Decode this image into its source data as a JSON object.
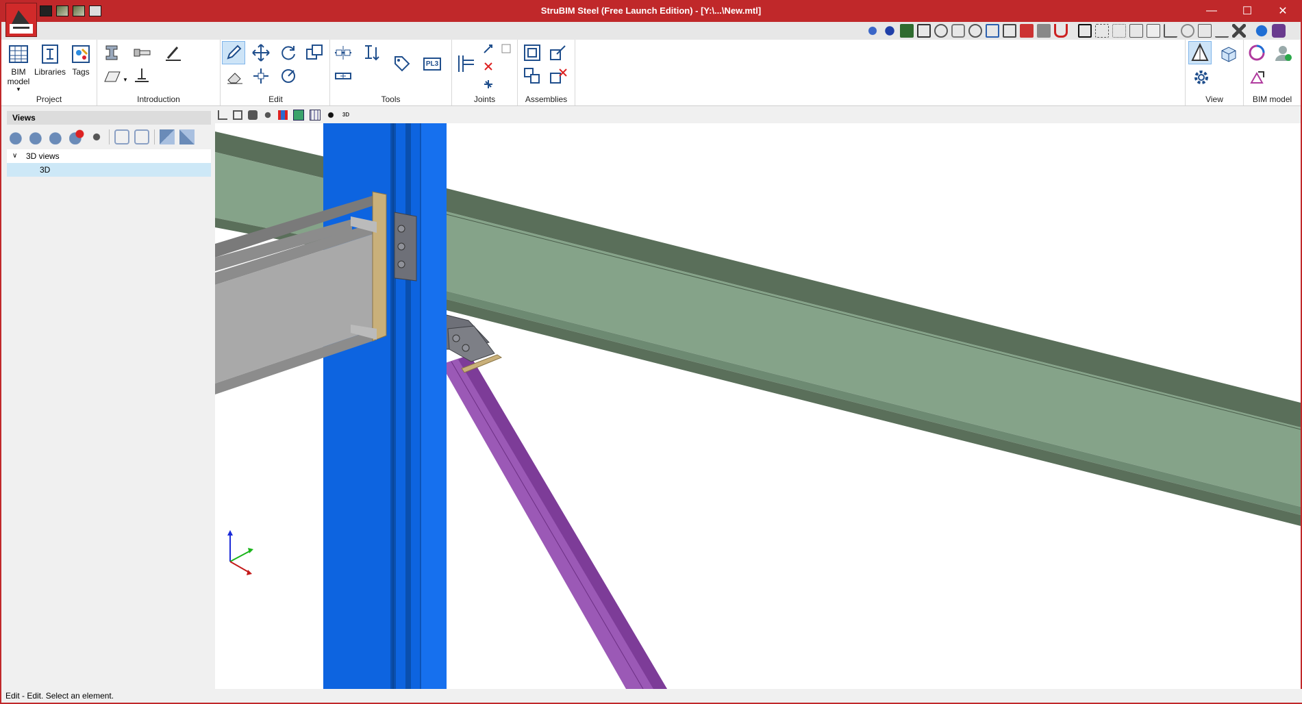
{
  "title": "StruBIM Steel (Free Launch Edition) - [Y:\\...\\New.mtl]",
  "window_buttons": {
    "minimize": "—",
    "maximize": "☐",
    "close": "✕"
  },
  "ribbon": {
    "groups": {
      "project": "Project",
      "introduction": "Introduction",
      "edit": "Edit",
      "tools": "Tools",
      "joints": "Joints",
      "assemblies": "Assemblies",
      "view": "View",
      "bim_model": "BIM model"
    },
    "buttons": {
      "bim_model": "BIM model",
      "libraries": "Libraries",
      "tags": "Tags",
      "plate_label": "PL3"
    }
  },
  "views_panel": {
    "title": "Views",
    "tree_group": "3D views",
    "tree_item": "3D"
  },
  "viewport_toolbar": {
    "view3d_label": "3D"
  },
  "status": "Edit - Edit. Select an element.",
  "colors": {
    "titlebar": "#c0282a",
    "column": "#0d64e0",
    "beam": "#85a389",
    "secondary_beam": "#a9a9a9",
    "brace": "#9b59b6"
  }
}
